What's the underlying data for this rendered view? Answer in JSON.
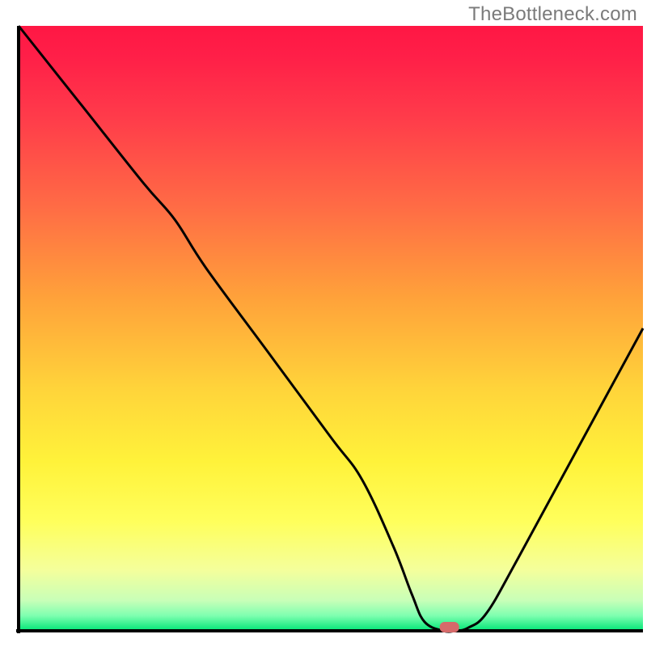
{
  "watermark": "TheBottleneck.com",
  "chart_data": {
    "type": "line",
    "title": "",
    "xlabel": "",
    "ylabel": "",
    "xlim": [
      0,
      100
    ],
    "ylim": [
      0,
      100
    ],
    "grid": false,
    "series": [
      {
        "name": "bottleneck-curve",
        "x": [
          0,
          10,
          20,
          25,
          30,
          40,
          50,
          55,
          60,
          63,
          65,
          68,
          70,
          72,
          75,
          80,
          90,
          100
        ],
        "y": [
          100,
          87,
          74,
          68,
          60,
          46,
          32,
          25,
          14,
          6,
          1.5,
          0,
          0,
          0.5,
          3,
          12,
          31,
          50
        ]
      }
    ],
    "marker": {
      "name": "optimal-point",
      "x": 69,
      "y": 0.6,
      "color": "#d66a6a"
    },
    "background": {
      "type": "vertical-gradient",
      "stops": [
        {
          "pos": 0.0,
          "color": "#ff1744"
        },
        {
          "pos": 0.05,
          "color": "#ff1f48"
        },
        {
          "pos": 0.15,
          "color": "#ff3b4a"
        },
        {
          "pos": 0.3,
          "color": "#ff6c45"
        },
        {
          "pos": 0.45,
          "color": "#ffa23a"
        },
        {
          "pos": 0.6,
          "color": "#ffd43a"
        },
        {
          "pos": 0.72,
          "color": "#fff23a"
        },
        {
          "pos": 0.82,
          "color": "#ffff5c"
        },
        {
          "pos": 0.9,
          "color": "#f4ff9c"
        },
        {
          "pos": 0.95,
          "color": "#c8ffb8"
        },
        {
          "pos": 0.975,
          "color": "#7effb0"
        },
        {
          "pos": 1.0,
          "color": "#00e676"
        }
      ]
    },
    "axes_color": "#000000",
    "line_color": "#000000",
    "line_width": 3
  }
}
